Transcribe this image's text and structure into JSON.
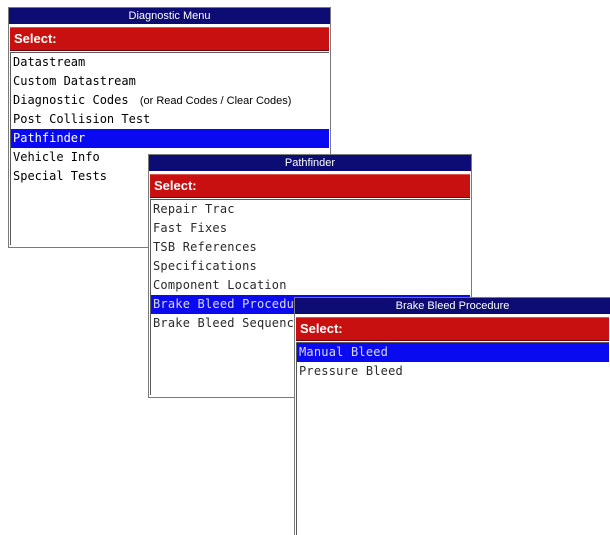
{
  "windows": {
    "diagnostic": {
      "title": "Diagnostic Menu",
      "header": "Select:",
      "items": [
        {
          "label": "Datastream"
        },
        {
          "label": "Custom Datastream"
        },
        {
          "label": "Diagnostic Codes",
          "note": "(or Read Codes / Clear Codes)"
        },
        {
          "label": "Post Collision Test"
        },
        {
          "label": "Pathfinder",
          "selected": true
        },
        {
          "label": "Vehicle Info"
        },
        {
          "label": "Special Tests"
        }
      ]
    },
    "pathfinder": {
      "title": "Pathfinder",
      "header": "Select:",
      "items": [
        {
          "label": "Repair Trac"
        },
        {
          "label": "Fast Fixes"
        },
        {
          "label": "TSB References"
        },
        {
          "label": "Specifications"
        },
        {
          "label": "Component Location"
        },
        {
          "label": "Brake Bleed Procedure",
          "selected": true
        },
        {
          "label": "Brake Bleed Sequence"
        }
      ]
    },
    "brake_bleed": {
      "title": "Brake Bleed Procedure",
      "header": "Select:",
      "items": [
        {
          "label": "Manual Bleed",
          "selected": true
        },
        {
          "label": "Pressure Bleed"
        }
      ]
    }
  },
  "colors": {
    "titlebar": "#0c0c74",
    "header": "#c81010",
    "selection": "#0a0af0"
  }
}
